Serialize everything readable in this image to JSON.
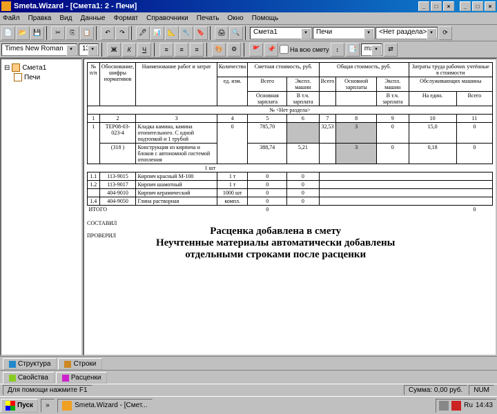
{
  "title": "Smeta.Wizard - [Смета1: 2 - Печи]",
  "menu": [
    "Файл",
    "Правка",
    "Вид",
    "Данные",
    "Формат",
    "Справочники",
    "Печать",
    "Окно",
    "Помощь"
  ],
  "combo": {
    "doc": "Смета1",
    "sheet": "Печи",
    "section": "<Нет раздела>"
  },
  "font": {
    "name": "Times New Roman",
    "size": "13"
  },
  "toolbar2": {
    "cb": "На всю смету",
    "mx": "mx"
  },
  "tree": {
    "root": "Смета1",
    "child": "Печи"
  },
  "headers": {
    "c1": "№ п/п",
    "c2": "Обоснование, шифры нормативов",
    "c3": "Наименование работ и затрат",
    "c4": "Количество",
    "c5": "Сметная стоимость, руб.",
    "c6": "Общая стоимость, руб.",
    "c7": "Затраты труда рабочих учтённые в стоимости",
    "r2a": "ед. изм.",
    "r2b": "Всего",
    "r2c": "Экспл. машин",
    "r2d": "Всего",
    "r2e": "Основной зарплаты",
    "r2f": "Экспл. машин",
    "r2g": "Обслуживающих машины",
    "r3a": "Основная зарплата",
    "r3b": "В т.ч. зарплата",
    "r3c": "В т.ч. зарплата",
    "r3d": "На един.",
    "r3e": "Всего",
    "r4": "№ <Нет раздела>"
  },
  "cols": [
    "1",
    "2",
    "3",
    "4",
    "5",
    "6",
    "7",
    "8",
    "9",
    "10",
    "11"
  ],
  "rows": {
    "r1": {
      "n": "1",
      "code": "ТЕР08-03-023-4",
      "name": "Кладка камина, камина отопительного. С одной подтопкой и 1 трубой",
      "u": "",
      "v": "0",
      "c5": "785,70",
      "c6": "",
      "c7": "32,53",
      "c8": "3",
      "c9": "0",
      "c10": "15,0",
      "c11": "0"
    },
    "r1b": {
      "code": "(318 )",
      "name": "Конструкция из кирпича и блоков с автономной системой отопления",
      "u": "1 шт",
      "c5": "388,74",
      "c6": "5,21",
      "c8": "3",
      "c9": "0",
      "c10": "0,18",
      "c11": "0"
    },
    "r2": {
      "n": "1.1",
      "code": "113-9015",
      "name": "Кирпич красный М-100",
      "u": "1 т",
      "v": "0",
      "c5": "0"
    },
    "r3": {
      "n": "1.2",
      "code": "113-9017",
      "name": "Кирпич шамотный",
      "u": "1 т",
      "v": "0",
      "c5": "0"
    },
    "r4": {
      "n": "",
      "code": "404-9010",
      "name": "Кирпич керамический",
      "u": "1000 шт",
      "v": "0",
      "c5": "0"
    },
    "r5": {
      "n": "1.4",
      "code": "404-9050",
      "name": "Глина растворная",
      "u": "компл.",
      "v": "0",
      "c5": "0"
    }
  },
  "totals": {
    "label": "ИТОГО",
    "v": "0",
    "c": "0"
  },
  "sign": {
    "a": "СОСТАВИЛ",
    "b": "ПРОВЕРИЛ"
  },
  "msg": {
    "l1": "Расценка добавлена в смету",
    "l2": "Неучтенные материалы автоматически добавлены",
    "l3": "отдельными строками после расценки"
  },
  "tabs": {
    "t1": "Структура",
    "t2": "Строки",
    "t3": "Свойства",
    "t4": "Расценки"
  },
  "status": {
    "help": "Для помощи нажмите F1",
    "sum": "Сумма: 0,00 руб.",
    "num": "NUM"
  },
  "taskbar": {
    "start": "Пуск",
    "app": "Smeta.Wizard - [Смет...",
    "clock": "14:43",
    "kb": "Ru"
  }
}
